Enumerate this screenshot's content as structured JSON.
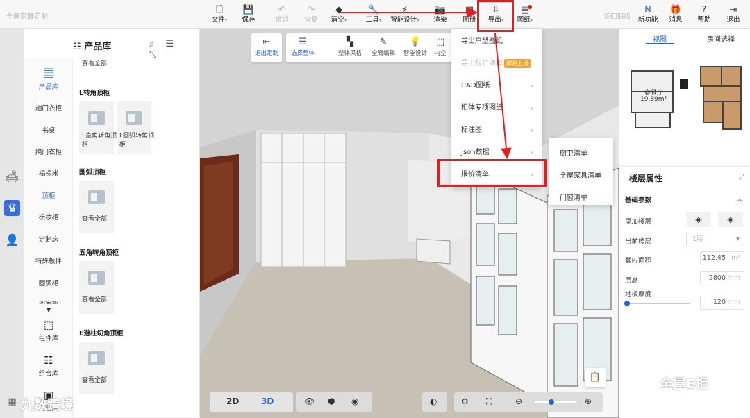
{
  "brand": "全屋家具定制",
  "toolbar": {
    "file": "文件",
    "save": "保存",
    "undo": "撤销",
    "redo": "恢复",
    "clear": "清空",
    "tools": "工具",
    "smart_design": "智能设计",
    "render": "渲染",
    "album": "图册",
    "export": "导出",
    "drawings": "图纸",
    "back_old": "返回旧版",
    "new_feature": "新功能",
    "messages": "消息",
    "help": "帮助",
    "exit": "退出"
  },
  "library": {
    "title": "产品库",
    "nav_label": "产品库",
    "categories": [
      "趟门衣柜",
      "书桌",
      "掩门衣柜",
      "榻榻米",
      "顶柜",
      "梳妆柜",
      "定制床",
      "特殊板件",
      "圆弧柜",
      "浴室柜"
    ],
    "active_category": "顶柜",
    "tools": [
      "组件库",
      "组合库",
      "门窗库"
    ],
    "top_fragment": "查看全部",
    "sections": [
      {
        "title": "L转角顶柜",
        "cards": [
          "L直角转角顶柜",
          "L圆弧转角顶柜"
        ]
      },
      {
        "title": "圆弧顶柜",
        "cards": [
          "查看全部"
        ]
      },
      {
        "title": "五角转角顶柜",
        "cards": [
          "查看全部"
        ]
      },
      {
        "title": "E避柱切角顶柜",
        "cards": [
          "查看全部"
        ]
      }
    ]
  },
  "scene_toolbar": {
    "exit_custom": "退出定制",
    "select_whole": "选择整体",
    "whole_style": "整体风格",
    "global_edit": "全局编辑",
    "smart_design": "智能设计",
    "inner_space": "内空"
  },
  "export_menu": {
    "items": [
      "导出户型图纸",
      "导出报价清单",
      "CAD图纸",
      "柜体专项图纸",
      "标注图",
      "Json数据",
      "报价清单"
    ],
    "tag": "即将上线"
  },
  "quote_submenu": [
    "厨卫清单",
    "全屋家具清单",
    "门窗清单"
  ],
  "view_panel": {
    "tabs": [
      "视图",
      "房间选择"
    ],
    "room_name": "客餐厅",
    "room_area": "19.89m²"
  },
  "floor_props": {
    "title": "楼层属性",
    "section": "基础参数",
    "add_floor": "添加楼层",
    "current_floor_label": "当前楼层",
    "current_floor": "1层",
    "inner_area_label": "套内面积",
    "inner_area": "112.45",
    "inner_area_unit": "m²",
    "height_label": "层高",
    "height": "2800",
    "height_unit": "mm",
    "floor_thickness_label": "地板厚度",
    "floor_thickness": "120",
    "floor_thickness_unit": "mm"
  },
  "bottom": {
    "mode_2d": "2D",
    "mode_3d": "3D",
    "active_mode": "3D"
  },
  "watermarks": {
    "left": "九数跨境",
    "right": "全屋E柜"
  },
  "colors": {
    "accent": "#2a62d4",
    "highlight": "#e02020",
    "tag": "#f3a525"
  }
}
